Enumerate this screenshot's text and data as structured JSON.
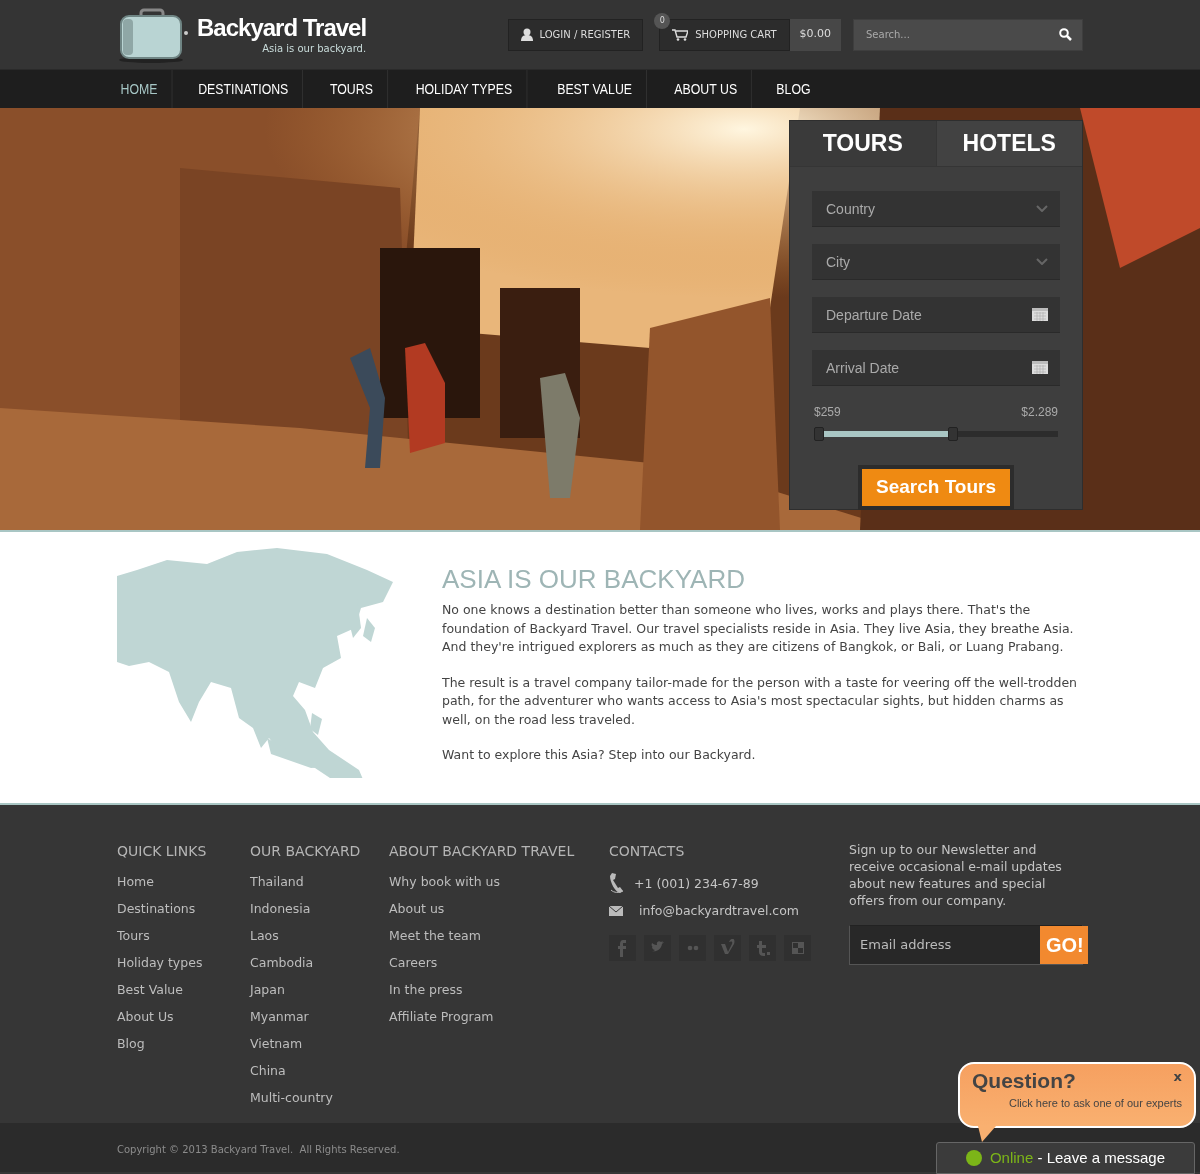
{
  "header": {
    "logo_title": "Backyard Travel",
    "logo_tagline": "Asia is our backyard.",
    "login": "LOGIN / REGISTER",
    "cart": {
      "count": "0",
      "label": "SHOPPING CART",
      "total": "$0.00"
    },
    "search": {
      "placeholder": "Search..."
    }
  },
  "nav": [
    {
      "label": "HOME",
      "selected": true
    },
    {
      "label": "DESTINATIONS",
      "selected": false
    },
    {
      "label": "TOURS",
      "selected": false
    },
    {
      "label": "HOLIDAY TYPES",
      "selected": false
    },
    {
      "label": "BEST VALUE",
      "selected": false
    },
    {
      "label": "ABOUT US",
      "selected": false
    },
    {
      "label": "BLOG",
      "selected": false
    }
  ],
  "booking": {
    "tabs": [
      {
        "label": "TOURS",
        "selected": true
      },
      {
        "label": "HOTELS",
        "selected": false
      }
    ],
    "fields": [
      {
        "kind": "select",
        "placeholder": "Country"
      },
      {
        "kind": "select",
        "placeholder": "City"
      },
      {
        "kind": "date",
        "placeholder": "Departure Date"
      },
      {
        "kind": "date",
        "placeholder": "Arrival Date"
      }
    ],
    "price_min": "$259",
    "price_max": "$2.289",
    "slider": {
      "level": 0.57
    },
    "button": "Search Tours"
  },
  "about": {
    "title": "ASIA IS OUR BACKYARD",
    "paragraphs": [
      "No one knows a destination better than someone who lives, works and plays there. That's the foundation of Backyard Travel. Our travel specialists reside in Asia. They live Asia, they breathe Asia. And they're intrigued explorers as much as they are citizens of Bangkok, or Bali, or Luang Prabang.",
      "The result is a travel company tailor-made for the person with a taste for veering off the well-trodden path, for the adventurer who wants access to Asia's most spectacular sights, but hidden charms as well, on the road less traveled.",
      "Want to explore this Asia? Step into our Backyard."
    ]
  },
  "footer": {
    "columns": [
      {
        "title": "QUICK LINKS",
        "links": [
          "Home",
          "Destinations",
          "Tours",
          "Holiday types",
          "Best Value",
          "About Us",
          "Blog"
        ]
      },
      {
        "title": "OUR BACKYARD",
        "links": [
          "Thailand",
          "Indonesia",
          "Laos",
          "Cambodia",
          "Japan",
          "Myanmar",
          "Vietnam",
          "China",
          "Multi-country"
        ]
      },
      {
        "title": "ABOUT BACKYARD TRAVEL",
        "links": [
          "Why book with us",
          "About us",
          "Meet the team",
          "Careers",
          "In the press",
          "Affiliate Program"
        ]
      }
    ],
    "contacts": {
      "title": "CONTACTS",
      "phone": "+1 (001) 234-67-89",
      "email": "info@backyardtravel.com"
    },
    "newsletter": {
      "text": "Sign up to our Newsletter and receive occasional e-mail updates about new features and special offers from our company.",
      "placeholder": "Email address",
      "button": "GO!"
    },
    "copyright": "Copyright © 2013 Backyard Travel.  All Rights Reserved."
  },
  "chat": {
    "title": "Question?",
    "subtitle": "Click here to ask one of our experts",
    "close": "x",
    "online": true,
    "status": "Online",
    "status_text": " - Leave a message"
  }
}
